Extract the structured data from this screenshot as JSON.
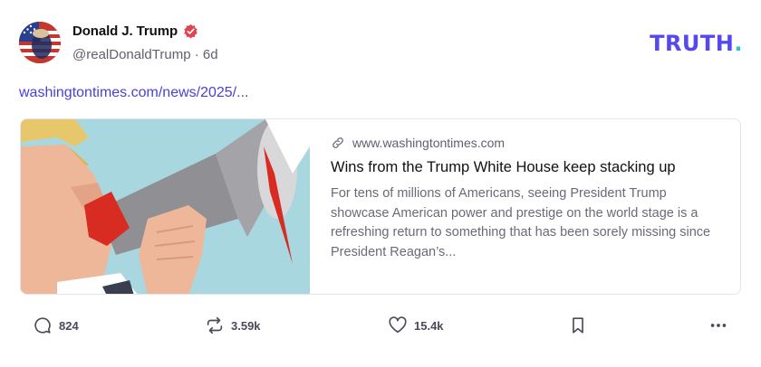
{
  "post": {
    "author": {
      "display_name": "Donald J. Trump",
      "handle": "@realDonaldTrump",
      "time_ago": "6d",
      "separator": "·",
      "verified": true
    },
    "brand": {
      "name": "TRUTH",
      "dot": ".",
      "color": "#5448ee",
      "dot_color": "#30c2c9"
    },
    "link_text": "washingtontimes.com/news/2025/...",
    "link_color": "#4a3fd8",
    "card": {
      "domain": "www.washingtontimes.com",
      "title": "Wins from the Trump White House keep stacking up",
      "description": "For tens of millions of Americans, seeing President Trump showcase American power and prestige on the world stage is a refreshing return to something that has been sorely missing since President Reagan’s..."
    },
    "actions": {
      "replies": {
        "icon": "reply-icon",
        "count": "824"
      },
      "retruths": {
        "icon": "retruth-icon",
        "count": "3.59k"
      },
      "likes": {
        "icon": "heart-icon",
        "count": "15.4k"
      },
      "save": {
        "icon": "bookmark-icon"
      },
      "more": {
        "icon": "more-icon"
      }
    }
  }
}
